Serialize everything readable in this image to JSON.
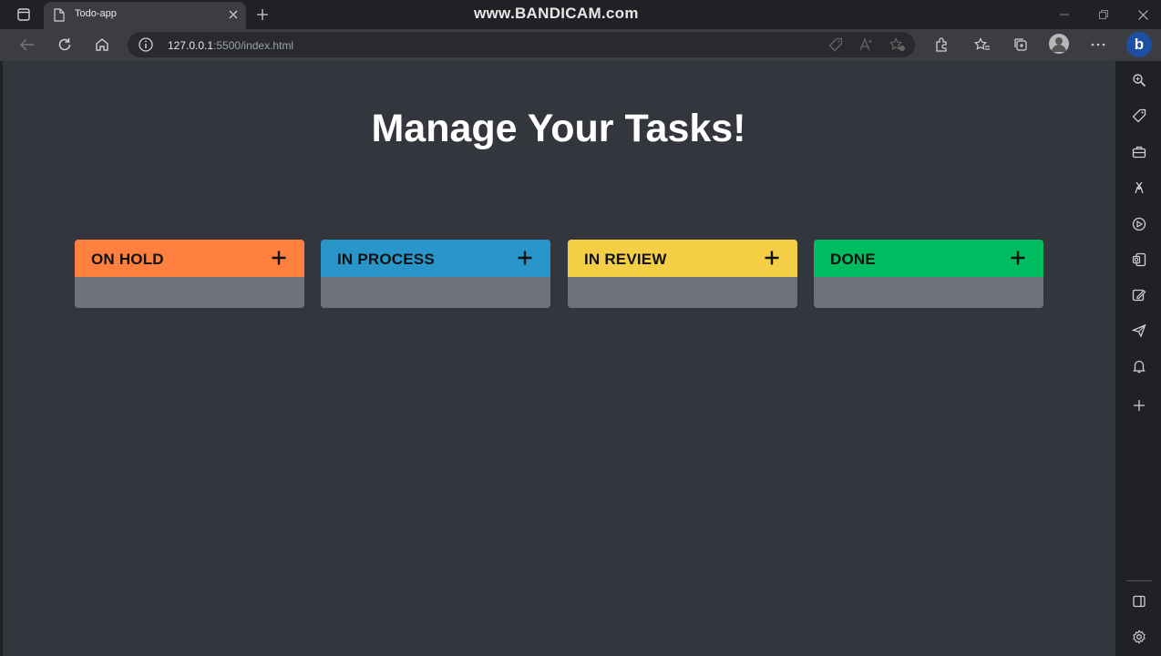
{
  "tab": {
    "title": "Todo-app"
  },
  "watermark": "www.BANDICAM.com",
  "address_bar": {
    "host": "127.0.0.1",
    "path": ":5500/index.html"
  },
  "page": {
    "heading": "Manage Your Tasks!",
    "columns": [
      {
        "title": "ON HOLD",
        "color": "#ff7f3f"
      },
      {
        "title": "IN PROCESS",
        "color": "#2a95c8"
      },
      {
        "title": "IN REVIEW",
        "color": "#f4cf46"
      },
      {
        "title": "DONE",
        "color": "#00bd61"
      }
    ]
  },
  "colors": {
    "page_background": "#33363d",
    "column_body": "#6e727c"
  }
}
